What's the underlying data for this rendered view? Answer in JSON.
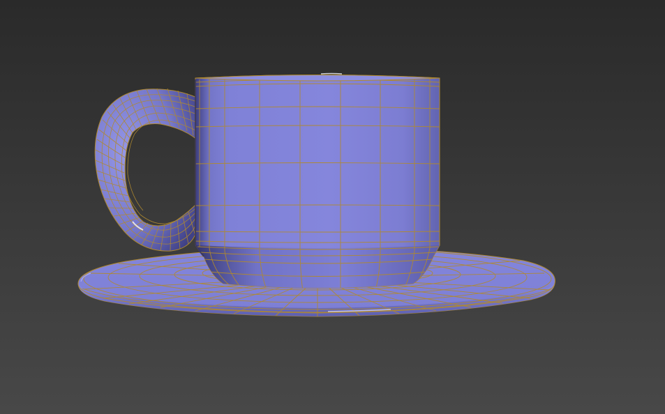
{
  "viewport": {
    "background_top": "#2b2b2b",
    "background_bottom": "#474747",
    "object_color": "#7f80d9",
    "wire_color": "#b08a2e",
    "object": "cup-and-saucer"
  }
}
